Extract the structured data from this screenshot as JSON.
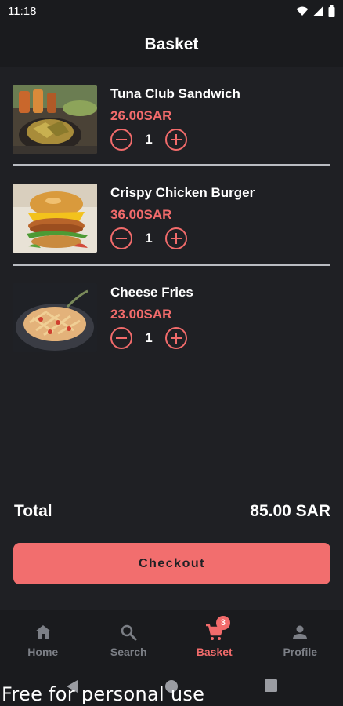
{
  "status_bar": {
    "time": "11:18"
  },
  "header": {
    "title": "Basket"
  },
  "basket": {
    "items": [
      {
        "name": "Tuna Club Sandwich",
        "price": "26.00SAR",
        "quantity": "1",
        "image": "sandwich-photo"
      },
      {
        "name": "Crispy Chicken Burger",
        "price": "36.00SAR",
        "quantity": "1",
        "image": "burger-photo"
      },
      {
        "name": "Cheese Fries",
        "price": "23.00SAR",
        "quantity": "1",
        "image": "fries-photo"
      }
    ]
  },
  "summary": {
    "total_label": "Total",
    "total_value": "85.00 SAR"
  },
  "checkout": {
    "label": "Checkout"
  },
  "tabs": [
    {
      "label": "Home",
      "icon": "home-icon"
    },
    {
      "label": "Search",
      "icon": "search-icon"
    },
    {
      "label": "Basket",
      "icon": "cart-icon",
      "badge": "3",
      "active": true
    },
    {
      "label": "Profile",
      "icon": "person-icon"
    }
  ],
  "watermark": "Free for personal use",
  "colors": {
    "accent": "#f26b6b",
    "background": "#1f2024",
    "bar": "#1a1b1e",
    "inactive_tab": "#7c7f86"
  }
}
